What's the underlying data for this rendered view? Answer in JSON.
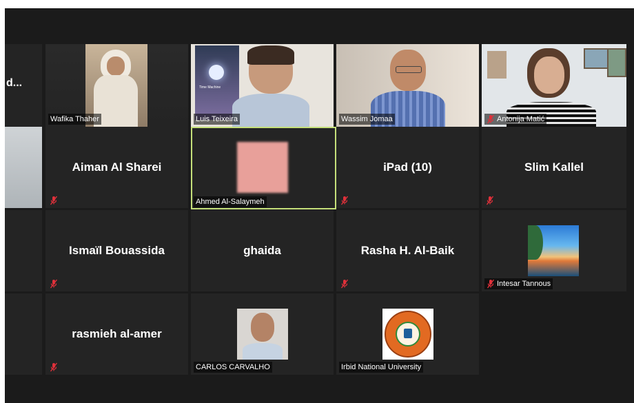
{
  "meeting": {
    "partial_tile_text": "d...",
    "active_speaker": "Ahmed Al-Salaymeh"
  },
  "participants": {
    "wafika": {
      "name": "Wafika Thaher"
    },
    "luis": {
      "name": "Luis Teixeira",
      "poster_text": "Time Machine"
    },
    "wassim": {
      "name": "Wassim Jomaa"
    },
    "antonija": {
      "name": "Antonija Matić"
    },
    "aiman": {
      "name": "Aiman Al Sharei"
    },
    "ahmed": {
      "name": "Ahmed Al-Salaymeh"
    },
    "ipad": {
      "name": "iPad (10)"
    },
    "slim": {
      "name": "Slim Kallel"
    },
    "ismail": {
      "name": "Ismaïl Bouassida"
    },
    "ghaida": {
      "name": "ghaida"
    },
    "rasha": {
      "name": "Rasha H. Al-Baik"
    },
    "intesar": {
      "name": "Intesar Tannous"
    },
    "rasmieh": {
      "name": "rasmieh al-amer"
    },
    "carlos": {
      "name": "CARLOS CARVALHO"
    },
    "irbid": {
      "name": "Irbid National University"
    }
  },
  "colors": {
    "stage_bg": "#1b1b1b",
    "tile_bg": "#242424",
    "active_border": "#c5e07a",
    "muted_icon": "#e0303a"
  }
}
